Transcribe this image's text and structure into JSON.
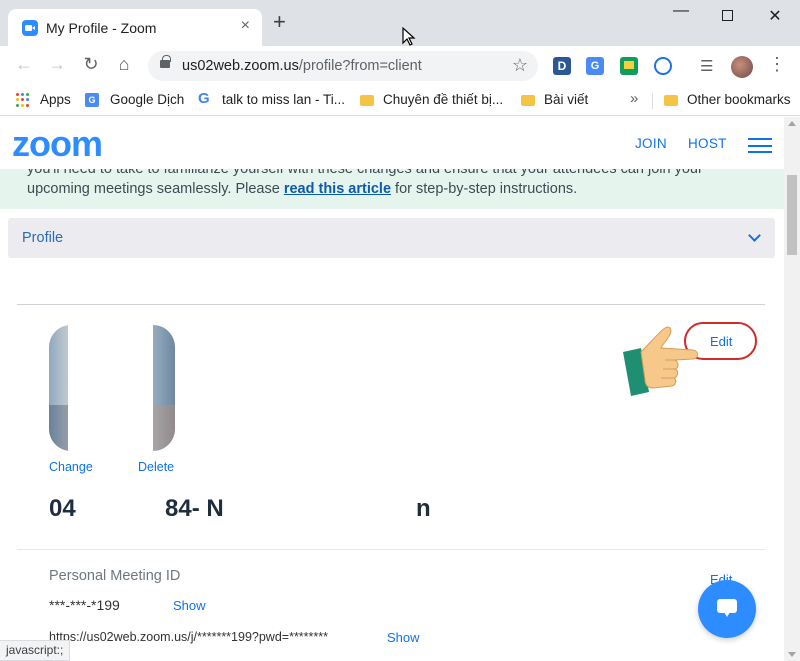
{
  "browser": {
    "tab_title": "My Profile - Zoom",
    "tab_close": "×",
    "new_tab": "+",
    "url_host": "us02web.zoom.us",
    "url_path": "/profile?from=client",
    "status_text": "javascript:;"
  },
  "bookmarks": {
    "items": [
      {
        "label": "Apps",
        "icon": "apps-grid-icon"
      },
      {
        "label": "Google Dịch",
        "icon": "google-translate-icon"
      },
      {
        "label": "talk to miss lan - Ti...",
        "icon": "google-icon"
      },
      {
        "label": "Chuyên đề thiết bị...",
        "icon": "folder-icon"
      },
      {
        "label": "Bài viết",
        "icon": "folder-icon"
      },
      {
        "label": "Other bookmarks",
        "icon": "folder-icon"
      }
    ],
    "more": "»"
  },
  "zoom_header": {
    "logo": "zoom",
    "join": "JOIN",
    "host": "HOST"
  },
  "notice": {
    "line1": "you'll need to take to familiarize yourself with these changes and ensure that your attendees can join your",
    "line2_prefix": "upcoming meetings seamlessly. Please ",
    "line2_link": "read this article",
    "line2_suffix": " for step-by-step instructions."
  },
  "profile_section": {
    "label": "Profile"
  },
  "profile": {
    "change": "Change",
    "delete": "Delete",
    "edit": "Edit",
    "name_part1": "04",
    "name_part2": "84- N",
    "name_part3": "n"
  },
  "meeting": {
    "label": "Personal Meeting ID",
    "id": "***-***-*199",
    "show": "Show",
    "edit_partial": "Edit",
    "url": "https://us02web.zoom.us/j/*******199?pwd=********",
    "url_show": "Show"
  },
  "colors": {
    "zoom_blue": "#2d8cff",
    "link_blue": "#0e72ed",
    "notice_bg": "#e5f4ec",
    "edit_ring": "#d02b2b"
  }
}
